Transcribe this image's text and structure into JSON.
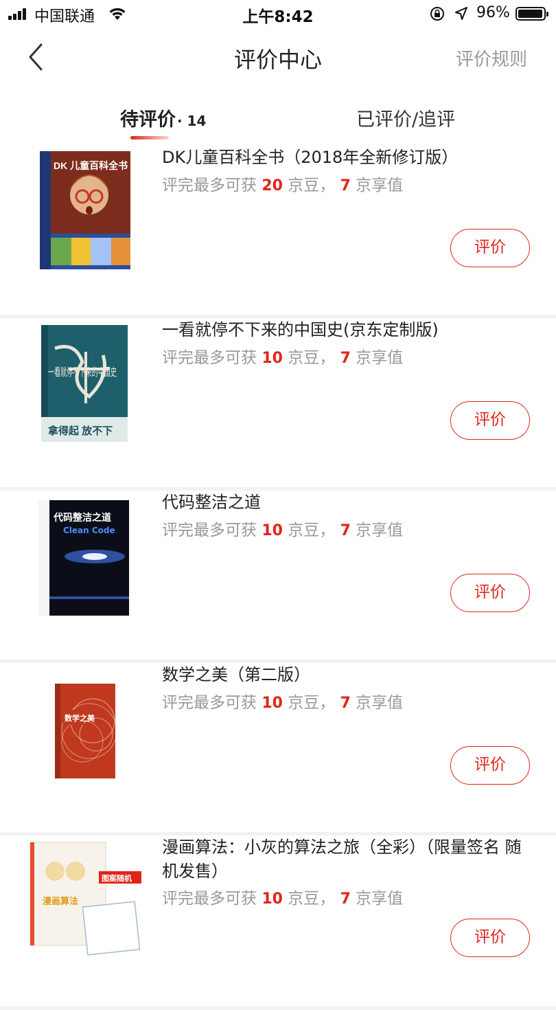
{
  "status_bar": {
    "carrier": "中国联通",
    "time": "上午8:42",
    "battery_percent": "96%",
    "battery_level": 0.96
  },
  "nav": {
    "title": "评价中心",
    "rules": "评价规则"
  },
  "tabs": {
    "pending_label": "待评价",
    "pending_count": "· 14",
    "done_label": "已评价/追评"
  },
  "items": [
    {
      "title": "DK儿童百科全书（2018年全新修订版）",
      "reward_prefix": "评完最多可获 ",
      "beans": "20",
      "beans_unit": " 京豆，",
      "points": "7",
      "points_unit": " 京享值",
      "button": "评价",
      "cover_text": "DK 儿童百科全书"
    },
    {
      "title": "一看就停不下来的中国史(京东定制版)",
      "reward_prefix": "评完最多可获 ",
      "beans": "10",
      "beans_unit": " 京豆，",
      "points": "7",
      "points_unit": " 京享值",
      "button": "评价",
      "cover_text": "一看就停不下来的中国史",
      "cover_banner": "拿得起 放不下"
    },
    {
      "title": "代码整洁之道",
      "reward_prefix": "评完最多可获 ",
      "beans": "10",
      "beans_unit": " 京豆，",
      "points": "7",
      "points_unit": " 京享值",
      "button": "评价",
      "cover_text": "代码整洁之道",
      "cover_sub": "Clean Code"
    },
    {
      "title": "数学之美（第二版）",
      "reward_prefix": "评完最多可获 ",
      "beans": "10",
      "beans_unit": " 京豆，",
      "points": "7",
      "points_unit": " 京享值",
      "button": "评价",
      "cover_text": "数学之美"
    },
    {
      "title": "漫画算法：小灰的算法之旅（全彩）（限量签名 随机发售）",
      "reward_prefix": "评完最多可获 ",
      "beans": "10",
      "beans_unit": " 京豆，",
      "points": "7",
      "points_unit": " 京享值",
      "button": "评价",
      "cover_text": "漫画算法",
      "cover_tag": "图案随机"
    }
  ],
  "colors": {
    "accent": "#e1251b",
    "muted": "#999999",
    "divider": "#f2f2f2"
  }
}
